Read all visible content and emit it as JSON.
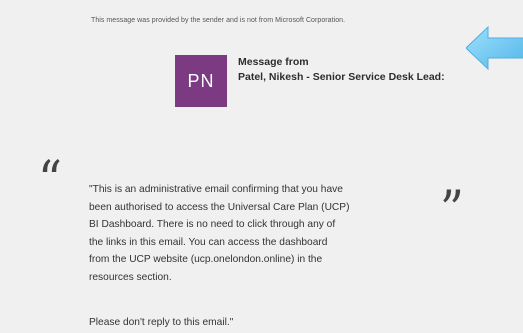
{
  "notice": {
    "text": "This message was provided by the sender and is not from Microsoft Corporation."
  },
  "sender": {
    "initials": "PN",
    "label": "Message from",
    "name": "Patel, Nikesh - Senior Service Desk Lead:",
    "avatar_color": "#7b3a82"
  },
  "message": {
    "lines": [
      "\"This is an administrative email confirming that you have",
      "been authorised to access the Universal Care Plan (UCP)",
      "BI Dashboard. There is no need to click through any of",
      "the links in this email. You can access the dashboard",
      "from the UCP website (ucp.onelondon.online) in the",
      "resources section."
    ],
    "closing": "Please don't reply to this email.\""
  },
  "quotes": {
    "open": "“",
    "close": "”"
  },
  "icons": {
    "pointer": "left-arrow-icon"
  },
  "colors": {
    "panel": "#f0f0f0",
    "avatar": "#7b3a82",
    "arrow": "#6ec7f3"
  }
}
